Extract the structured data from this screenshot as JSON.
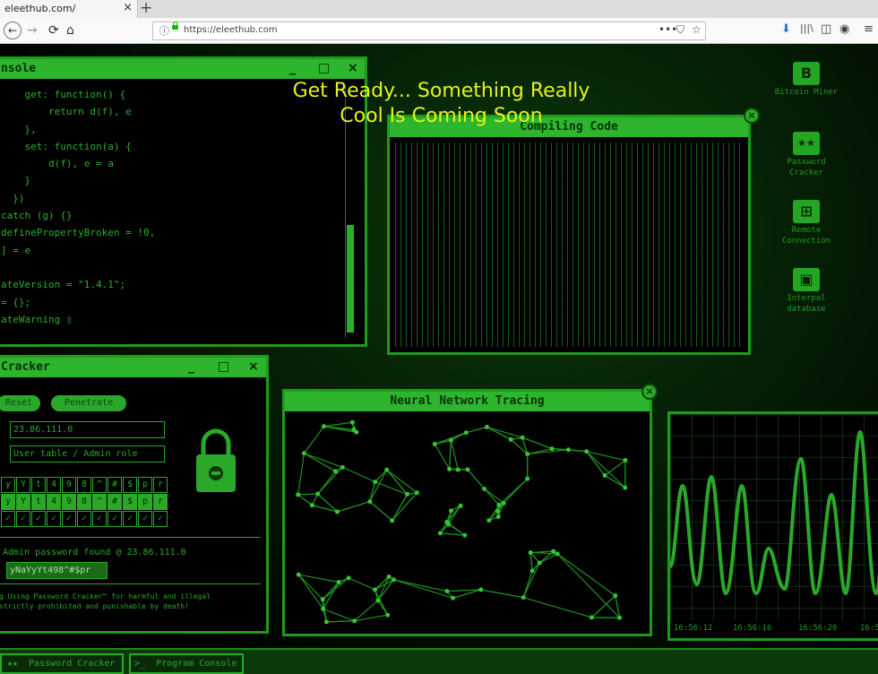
{
  "browser": {
    "tab_title": "eleethub.com/",
    "tab_close": "×",
    "new_tab": "+",
    "url_info": "ⓘ",
    "url": "https://eleethub.com",
    "url_menu": "•••",
    "nav": {
      "back": "←",
      "forward": "→",
      "reload": "⟳",
      "home": "⌂"
    },
    "toolbar_icons": {
      "pocket": "⛉",
      "bookmark": "☆",
      "download": "⬇",
      "library": "|||\\",
      "sidebar": "◫",
      "sync": "◉",
      "menu": "≡"
    }
  },
  "headline": {
    "line1": "Get Ready... Something Really",
    "line2": "Cool Is Coming Soon"
  },
  "console": {
    "title": "nsole",
    "controls": [
      "_",
      "□",
      "×"
    ],
    "code_lines": [
      "    get: function() {",
      "        return d(f), e",
      "    },",
      "    set: function(a) {",
      "        d(f), e = a",
      "    }",
      "  })",
      "catch (g) {}",
      "definePropertyBroken = !0,",
      "] = e",
      "",
      "ateVersion = \"1.4.1\";",
      "= {};",
      "ateWarning ▯"
    ]
  },
  "compiling": {
    "title": "Compiling Code",
    "close": "×"
  },
  "cracker": {
    "title": "Cracker",
    "controls": [
      "_",
      "□",
      "×"
    ],
    "reset": "Reset",
    "penetrate": "Penetrate",
    "ip_value": "23.86.111.0",
    "role_placeholder": "User table / Admin role",
    "grid_top": [
      "y",
      "Y",
      "t",
      "4",
      "9",
      "8",
      "^",
      "#",
      "$",
      "p",
      "r"
    ],
    "grid_mid": [
      "y",
      "Y",
      "t",
      "4",
      "9",
      "8",
      "^",
      "#",
      "$",
      "p",
      "r"
    ],
    "grid_checks": [
      "✓",
      "✓",
      "✓",
      "✓",
      "✓",
      "✓",
      "✓",
      "✓",
      "✓",
      "✓",
      "✓"
    ],
    "found_line": "Admin password found @ 23.86.111.0",
    "password": "yNaYyYt498^#$pr",
    "disclaimer_line1": "g Using Password Cracker™ for harmful and illegal",
    "disclaimer_line2": "strictly prohibited and punishable by death!"
  },
  "neural": {
    "title": "Neural Network Tracing",
    "close": "×"
  },
  "graph": {
    "time_labels": [
      "16:56:12",
      "16:56:16",
      "16:56:20",
      "16:5"
    ]
  },
  "desktop_icons": [
    {
      "glyph": "B",
      "label": "Bitcoin Miner"
    },
    {
      "glyph": "★★",
      "label": "Password Cracker"
    },
    {
      "glyph": "⊞",
      "label": "Remote Connection"
    },
    {
      "glyph": "▣",
      "label": "Interpol database"
    }
  ],
  "taskbar": {
    "btn1_icon": "★★",
    "btn1": "Password Cracker",
    "btn2_icon": ">_",
    "btn2": "Program Console"
  },
  "colors": {
    "accent": "#2db52d",
    "headline": "#e6f21b",
    "bg": "#000000"
  }
}
